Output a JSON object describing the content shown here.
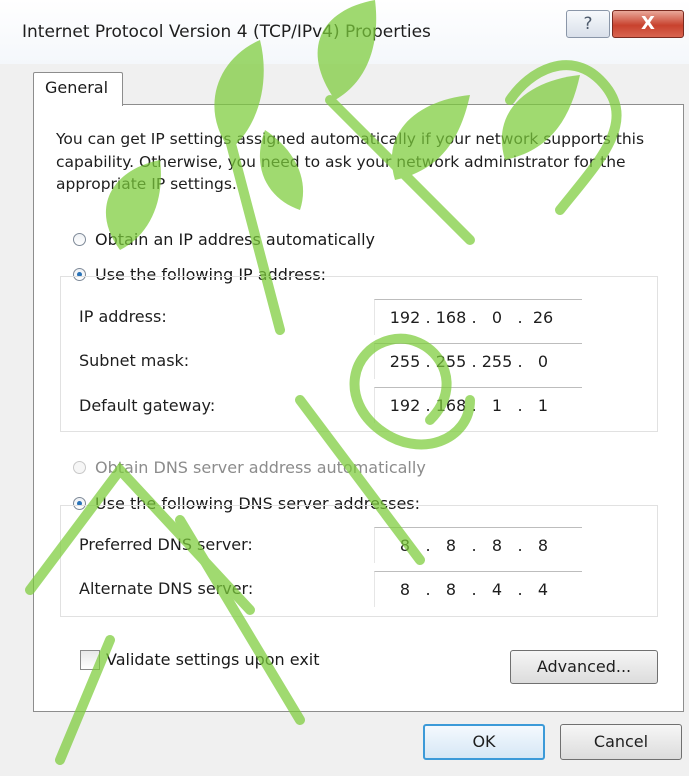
{
  "window": {
    "title": "Internet Protocol Version 4 (TCP/IPv4) Properties",
    "help_glyph": "?",
    "close_glyph": "X"
  },
  "tabs": [
    {
      "label": "General"
    }
  ],
  "intro_text": "You can get IP settings assigned automatically if your network supports this capability. Otherwise, you need to ask your network administrator for the appropriate IP settings.",
  "ip_mode": {
    "auto_label": "Obtain an IP address automatically",
    "manual_label": "Use the following IP address:",
    "selected": "manual"
  },
  "ip_fields": [
    {
      "label": "IP address:",
      "octets": [
        "192",
        "168",
        "0",
        "26"
      ]
    },
    {
      "label": "Subnet mask:",
      "octets": [
        "255",
        "255",
        "255",
        "0"
      ]
    },
    {
      "label": "Default gateway:",
      "octets": [
        "192",
        "168",
        "1",
        "1"
      ]
    }
  ],
  "dns_mode": {
    "auto_label": "Obtain DNS server address automatically",
    "manual_label": "Use the following DNS server addresses:",
    "selected": "manual"
  },
  "dns_fields": [
    {
      "label": "Preferred DNS server:",
      "octets": [
        "8",
        "8",
        "8",
        "8"
      ]
    },
    {
      "label": "Alternate DNS server:",
      "octets": [
        "8",
        "8",
        "4",
        "4"
      ]
    }
  ],
  "validate_checkbox": {
    "label": "Validate settings upon exit",
    "checked": false
  },
  "buttons": {
    "advanced": "Advanced...",
    "ok": "OK",
    "cancel": "Cancel"
  },
  "colors": {
    "watermark": "#7ccc3a",
    "radio_selected": "#2a73b8",
    "default_button_border": "#3c9ad8",
    "close_button": "#c8422e"
  }
}
